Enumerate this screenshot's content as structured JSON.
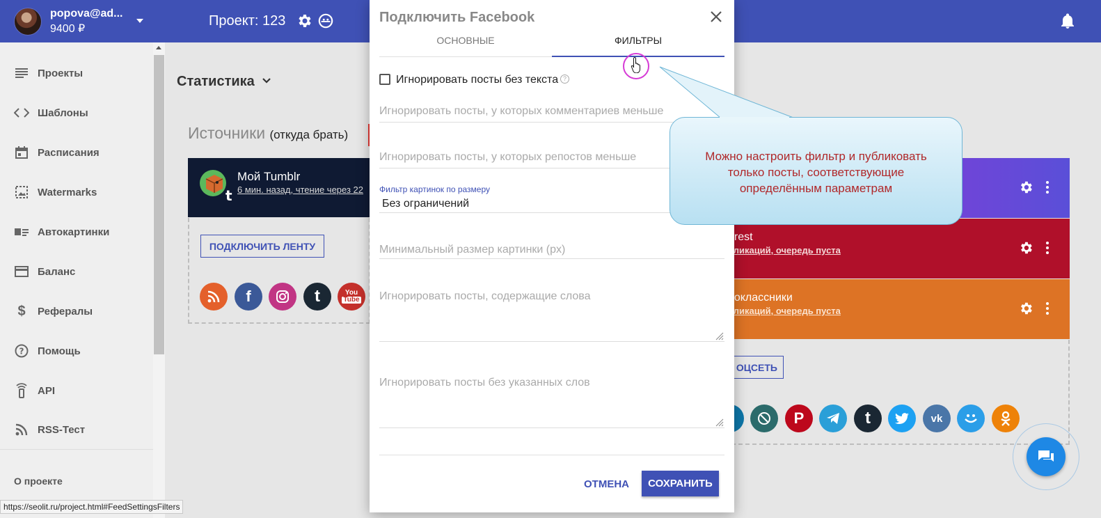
{
  "topbar": {
    "user_email": "popova@ad...",
    "user_balance": "9400 ₽",
    "project": "Проект: 123"
  },
  "sidebar": {
    "items": [
      {
        "label": "Проекты",
        "icon": "list-icon"
      },
      {
        "label": "Шаблоны",
        "icon": "code-icon"
      },
      {
        "label": "Расписания",
        "icon": "calendar-icon"
      },
      {
        "label": "Watermarks",
        "icon": "image-watermark-icon"
      },
      {
        "label": "Автокартинки",
        "icon": "auto-image-icon"
      },
      {
        "label": "Баланс",
        "icon": "credit-card-icon"
      },
      {
        "label": "Рефералы",
        "icon": "dollar-icon"
      },
      {
        "label": "Помощь",
        "icon": "help-icon"
      },
      {
        "label": "API",
        "icon": "api-icon"
      },
      {
        "label": "RSS-Тест",
        "icon": "rss-icon"
      }
    ],
    "about": "О проекте"
  },
  "main": {
    "stat_title": "Статистика",
    "sources_title": "Источники",
    "sources_sub": "(откуда брать)",
    "feed_name": "Мой Tumblr",
    "feed_meta": "6 мин. назад, чтение через 22",
    "connect_feed": "ПОДКЛЮЧИТЬ ЛЕНТУ",
    "right_cards": [
      {
        "name": "erest",
        "meta": "бликаций, очередь пуста",
        "color": "#b0102a"
      },
      {
        "name": "ноклассники",
        "meta": "бликаций, очередь пуста",
        "color": "#dd7325"
      }
    ],
    "connect_social": "ОЦСЕТЬ"
  },
  "modal": {
    "title": "Подключить Facebook",
    "tabs": [
      "ОСНОВНЫЕ",
      "ФИЛЬТРЫ"
    ],
    "checkbox_label": "Игнорировать посты без текста",
    "help": "?",
    "comments_placeholder": "Игнорировать посты, у которых комментариев меньше",
    "reposts_placeholder": "Игнорировать посты, у которых репостов меньше",
    "image_filter_label": "Фильтр картинок по размеру",
    "image_filter_value": "Без ограничений",
    "min_size_placeholder": "Минимальный размер картинки (px)",
    "contains_words_placeholder": "Игнорировать посты, содержащие слова",
    "without_words_placeholder": "Игнорировать посты без указанных слов",
    "cancel": "ОТМЕНА",
    "save": "СОХРАНИТЬ"
  },
  "tooltip": {
    "line1": "Можно настроить фильтр и публиковать",
    "line2": "только посты, соответствующие",
    "line3": "определённым параметрам"
  },
  "status_url": "https://seolit.ru/project.html#FeedSettingsFilters",
  "colors": {
    "primary": "#3f51b5",
    "tooltip_text": "#b0282a"
  }
}
